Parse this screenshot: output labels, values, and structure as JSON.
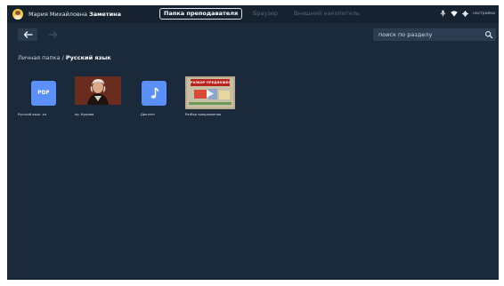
{
  "header": {
    "user_first": "Мария Михайловна",
    "user_last": "Заметина",
    "tabs": [
      {
        "label": "Папка преподавателя",
        "active": true
      },
      {
        "label": "Браузер",
        "active": false
      },
      {
        "label": "Внешний накопитель",
        "active": false
      }
    ],
    "settings_label": "настройки"
  },
  "nav": {
    "back_icon": "arrow-left-icon",
    "forward_icon": "arrow-right-icon"
  },
  "search": {
    "placeholder": "поиск по разделу",
    "icon": "search-icon"
  },
  "breadcrumb": {
    "root": "Личная папка",
    "separator": "/",
    "current": "Русский язык"
  },
  "files": [
    {
      "type": "pdf",
      "badge": "PDF",
      "label": "Русский язык. кл"
    },
    {
      "type": "image",
      "label": "пр. Крылов"
    },
    {
      "type": "audio",
      "label": "Диктант"
    },
    {
      "type": "video",
      "thumb_text": "РАЗБОР ПРЕДЛОЖЕНИЯ",
      "label": "Разбор предложения"
    }
  ],
  "colors": {
    "background": "#1b2a3b",
    "header": "#16222f",
    "file_icon": "#5b8ff9",
    "search_bg": "#2c3d51",
    "avatar": "#f2c84b"
  }
}
